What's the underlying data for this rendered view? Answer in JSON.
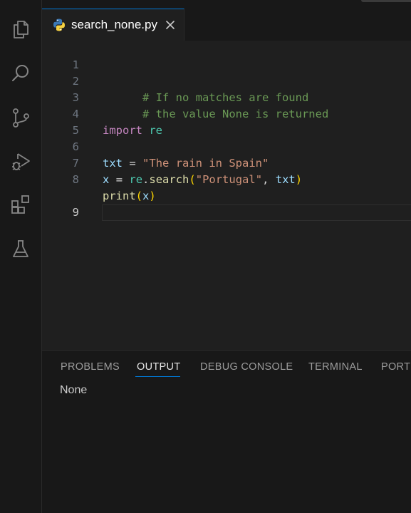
{
  "activity_bar": {
    "items": [
      {
        "name": "explorer",
        "icon": "files-icon"
      },
      {
        "name": "search",
        "icon": "search-icon"
      },
      {
        "name": "source-control",
        "icon": "source-control-icon"
      },
      {
        "name": "run-and-debug",
        "icon": "run-debug-icon"
      },
      {
        "name": "extensions",
        "icon": "extensions-icon"
      },
      {
        "name": "testing",
        "icon": "flask-icon"
      }
    ]
  },
  "tab": {
    "filename": "search_none.py",
    "icon": "python-icon",
    "close_icon": "close-icon"
  },
  "editor": {
    "lines": [
      {
        "num": "1",
        "code": "# If no matches are found"
      },
      {
        "num": "2",
        "code": "# the value None is returned"
      },
      {
        "num": "3",
        "code": ""
      },
      {
        "num": "4",
        "code": "import re"
      },
      {
        "num": "5",
        "code": ""
      },
      {
        "num": "6",
        "code": "txt = \"The rain in Spain\""
      },
      {
        "num": "7",
        "code": "x = re.search(\"Portugal\", txt)"
      },
      {
        "num": "8",
        "code": "print(x)"
      },
      {
        "num": "9",
        "code": ""
      }
    ],
    "tokens": {
      "l1": "# If no matches are found",
      "l2": "# the value None is returned",
      "l4_kw": "import",
      "l4_mod": "re",
      "l6_var": "txt",
      "l6_op": "=",
      "l6_str": "\"The rain in Spain\"",
      "l7_var": "x",
      "l7_op": "=",
      "l7_mod": "re",
      "l7_dot": ".",
      "l7_func": "search",
      "l7_lp": "(",
      "l7_str": "\"Portugal\"",
      "l7_comma": ",",
      "l7_arg": "txt",
      "l7_rp": ")",
      "l8_func": "print",
      "l8_lp": "(",
      "l8_arg": "x",
      "l8_rp": ")"
    },
    "active_line": "9"
  },
  "panel": {
    "tabs": [
      {
        "label": "PROBLEMS",
        "active": false
      },
      {
        "label": "OUTPUT",
        "active": true
      },
      {
        "label": "DEBUG CONSOLE",
        "active": false
      },
      {
        "label": "TERMINAL",
        "active": false
      },
      {
        "label": "PORTS",
        "active": false
      }
    ],
    "output": "None"
  },
  "colors": {
    "accent": "#0078d4",
    "comment": "#6a9955",
    "keyword": "#c586c0",
    "module": "#4ec9b0",
    "variable": "#9cdcfe",
    "string": "#ce9178",
    "function": "#dcdcaa",
    "bracket": "#ffd700"
  }
}
